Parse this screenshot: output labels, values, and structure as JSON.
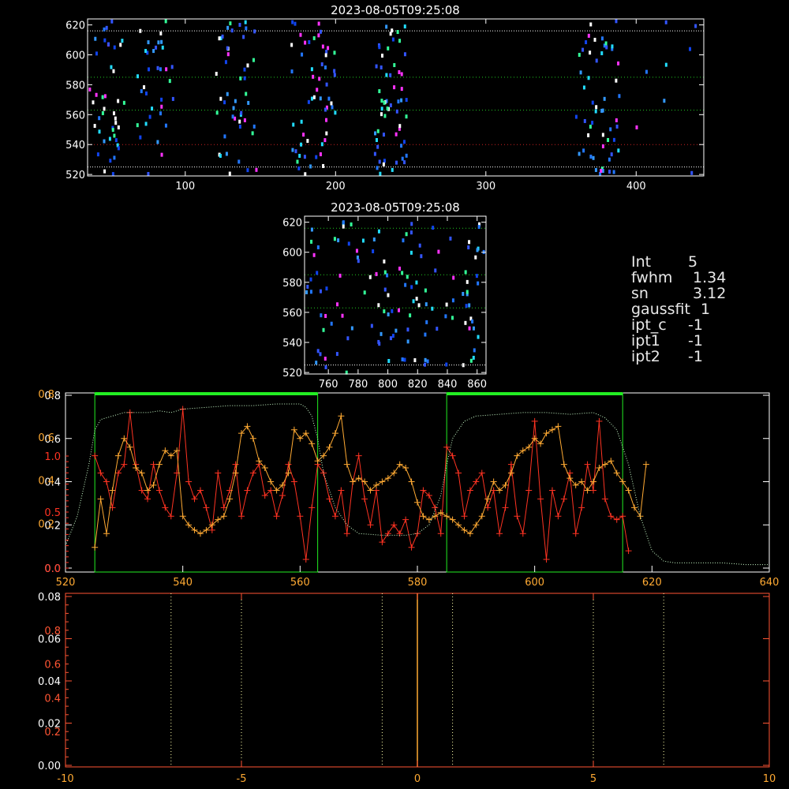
{
  "colors": {
    "axis": "#ffffff",
    "grid_green": "#22cc22",
    "grid_red": "#cc2222",
    "band_green": "#22ee22",
    "red_series": "#ff3322",
    "orange_series": "#ffaa33",
    "dotted_series": "#ccffcc",
    "lower_axis": "#ff5533",
    "lower_center": "#ffaa33",
    "lower_dotted": "#ffffaa"
  },
  "top_panel": {
    "title": "2023-08-05T09:25:08",
    "xlim": [
      35,
      445
    ],
    "ylim": [
      519,
      624
    ],
    "xticks": [
      100,
      200,
      300,
      400
    ],
    "yticks": [
      520,
      540,
      560,
      580,
      600,
      620
    ],
    "hlines_green": [
      585,
      563
    ],
    "hlines_red": [
      540
    ],
    "hlines_white": [
      616,
      525
    ],
    "clusters": [
      {
        "x": [
          36,
          60
        ],
        "n": 42
      },
      {
        "x": [
          68,
          92
        ],
        "n": 34
      },
      {
        "x": [
          120,
          148
        ],
        "n": 46
      },
      {
        "x": [
          170,
          200
        ],
        "n": 56
      },
      {
        "x": [
          226,
          248
        ],
        "n": 58
      },
      {
        "x": [
          360,
          390
        ],
        "n": 54
      },
      {
        "x": [
          400,
          440
        ],
        "n": 8
      }
    ]
  },
  "zoom_panel": {
    "title": "2023-08-05T09:25:08",
    "xlim": [
      744,
      866
    ],
    "ylim": [
      519,
      624
    ],
    "xticks": [
      760,
      780,
      800,
      820,
      840,
      860
    ],
    "yticks": [
      520,
      540,
      560,
      580,
      600,
      620
    ],
    "hlines_green": [
      616,
      585,
      563
    ],
    "hlines_white": [
      525
    ],
    "n_points": 130
  },
  "info": [
    {
      "key": "Int",
      "value": "5"
    },
    {
      "key": "fwhm",
      "value": " 1.34"
    },
    {
      "key": "sn",
      "value": " 3.12"
    },
    {
      "key": "gaussfit",
      "value": "1"
    },
    {
      "key": "ipt_c",
      "value": "-1"
    },
    {
      "key": "ipt1",
      "value": "-1"
    },
    {
      "key": "ipt2",
      "value": "-1"
    }
  ],
  "chart_data": [
    {
      "type": "line",
      "xlim": [
        520,
        640
      ],
      "ylim_left": [
        0,
        1.0
      ],
      "xticks": [
        520,
        540,
        560,
        580,
        600,
        620,
        640
      ],
      "left_ticks_red": [
        "0.0",
        "0.5",
        "1.0"
      ],
      "left_ticks_red_values": [
        0,
        0.5,
        1.0
      ],
      "left_ticks_white": [
        "0.0",
        "0.2",
        "0.4",
        "0.6",
        "0.8"
      ],
      "left_ticks_white_values": [
        0,
        0.2,
        0.4,
        0.6,
        0.8
      ],
      "left_ticks_orange": [
        "0.2",
        "0.4",
        "0.6",
        "0.8"
      ],
      "left_ticks_orange_values": [
        0.2,
        0.4,
        0.6,
        0.8
      ],
      "bands": [
        [
          525,
          563
        ],
        [
          585,
          615
        ]
      ],
      "series": [
        {
          "color": "red",
          "x": [
            525,
            526,
            527,
            528,
            529,
            530,
            531,
            532,
            533,
            534,
            535,
            536,
            537,
            538,
            539,
            540,
            541,
            542,
            543,
            544,
            545,
            546,
            547,
            548,
            549,
            550,
            551,
            552,
            553,
            554,
            555,
            556,
            557,
            558,
            559,
            560,
            561,
            562,
            563,
            564,
            565,
            566,
            567,
            568,
            569,
            570,
            571,
            572,
            573,
            574,
            575,
            576,
            577,
            578,
            579,
            580,
            581,
            582,
            583,
            584,
            585,
            586,
            587,
            588,
            589,
            590,
            591,
            592,
            593,
            594,
            595,
            596,
            597,
            598,
            599,
            600,
            601,
            602,
            603,
            604,
            605,
            606,
            607,
            608,
            609,
            610,
            611,
            612,
            613,
            614,
            615,
            616
          ],
          "y": [
            0.65,
            0.55,
            0.5,
            0.35,
            0.55,
            0.6,
            0.9,
            0.6,
            0.45,
            0.4,
            0.6,
            0.45,
            0.35,
            0.3,
            0.55,
            0.92,
            0.5,
            0.4,
            0.45,
            0.35,
            0.22,
            0.55,
            0.35,
            0.45,
            0.6,
            0.3,
            0.45,
            0.55,
            0.6,
            0.42,
            0.45,
            0.3,
            0.42,
            0.6,
            0.5,
            0.3,
            0.05,
            0.35,
            0.6,
            0.55,
            0.4,
            0.3,
            0.45,
            0.2,
            0.5,
            0.65,
            0.4,
            0.25,
            0.45,
            0.15,
            0.2,
            0.25,
            0.2,
            0.28,
            0.12,
            0.2,
            0.45,
            0.42,
            0.35,
            0.2,
            0.7,
            0.65,
            0.55,
            0.3,
            0.45,
            0.5,
            0.55,
            0.35,
            0.45,
            0.2,
            0.35,
            0.6,
            0.3,
            0.2,
            0.45,
            0.85,
            0.4,
            0.05,
            0.45,
            0.3,
            0.4,
            0.55,
            0.2,
            0.35,
            0.6,
            0.45,
            0.85,
            0.4,
            0.3,
            0.28,
            0.3,
            0.1
          ]
        },
        {
          "color": "orange",
          "x": [
            525,
            526,
            527,
            528,
            529,
            530,
            531,
            532,
            533,
            534,
            535,
            536,
            537,
            538,
            539,
            540,
            541,
            542,
            543,
            544,
            545,
            546,
            547,
            548,
            549,
            550,
            551,
            552,
            553,
            554,
            555,
            556,
            557,
            558,
            559,
            560,
            561,
            562,
            563,
            564,
            565,
            566,
            567,
            568,
            569,
            570,
            571,
            572,
            573,
            574,
            575,
            576,
            577,
            578,
            579,
            580,
            581,
            582,
            583,
            584,
            585,
            586,
            587,
            588,
            589,
            590,
            591,
            592,
            593,
            594,
            595,
            596,
            597,
            598,
            599,
            600,
            601,
            602,
            603,
            604,
            605,
            606,
            607,
            608,
            609,
            610,
            611,
            612,
            613,
            614,
            615,
            616,
            617,
            618,
            619
          ],
          "y": [
            0.12,
            0.4,
            0.2,
            0.45,
            0.65,
            0.75,
            0.7,
            0.58,
            0.55,
            0.45,
            0.48,
            0.6,
            0.68,
            0.65,
            0.68,
            0.3,
            0.25,
            0.22,
            0.2,
            0.22,
            0.25,
            0.28,
            0.3,
            0.4,
            0.55,
            0.78,
            0.82,
            0.75,
            0.62,
            0.58,
            0.5,
            0.45,
            0.48,
            0.55,
            0.8,
            0.75,
            0.78,
            0.72,
            0.62,
            0.65,
            0.7,
            0.78,
            0.88,
            0.6,
            0.5,
            0.52,
            0.5,
            0.45,
            0.48,
            0.5,
            0.52,
            0.55,
            0.6,
            0.58,
            0.5,
            0.38,
            0.3,
            0.28,
            0.3,
            0.32,
            0.3,
            0.28,
            0.25,
            0.22,
            0.2,
            0.25,
            0.3,
            0.4,
            0.5,
            0.45,
            0.48,
            0.55,
            0.65,
            0.68,
            0.7,
            0.75,
            0.72,
            0.78,
            0.8,
            0.82,
            0.6,
            0.52,
            0.48,
            0.5,
            0.45,
            0.5,
            0.58,
            0.6,
            0.62,
            0.55,
            0.5,
            0.45,
            0.35,
            0.3,
            0.6
          ]
        },
        {
          "color": "dotted",
          "x": [
            520,
            522,
            524,
            525,
            526,
            528,
            530,
            532,
            534,
            536,
            538,
            540,
            544,
            548,
            552,
            556,
            560,
            561,
            562,
            563,
            564,
            566,
            568,
            570,
            574,
            578,
            580,
            582,
            584,
            585,
            586,
            588,
            590,
            594,
            598,
            602,
            606,
            610,
            612,
            614,
            616,
            618,
            620,
            622,
            624,
            628,
            632,
            636,
            640
          ],
          "y": [
            0.13,
            0.3,
            0.6,
            0.8,
            0.86,
            0.88,
            0.9,
            0.9,
            0.9,
            0.91,
            0.9,
            0.92,
            0.93,
            0.94,
            0.94,
            0.95,
            0.95,
            0.93,
            0.88,
            0.75,
            0.55,
            0.35,
            0.25,
            0.2,
            0.19,
            0.19,
            0.2,
            0.25,
            0.42,
            0.6,
            0.75,
            0.85,
            0.88,
            0.89,
            0.9,
            0.9,
            0.89,
            0.9,
            0.87,
            0.8,
            0.6,
            0.3,
            0.1,
            0.04,
            0.03,
            0.03,
            0.03,
            0.02,
            0.02
          ]
        }
      ]
    },
    {
      "type": "line",
      "xlim": [
        -10,
        10
      ],
      "xticks": [
        -10,
        -5,
        0,
        5,
        10
      ],
      "left_ticks_white": [
        "0.00",
        "0.02",
        "0.04",
        "0.06",
        "0.08"
      ],
      "left_ticks_white_values": [
        0,
        0.02,
        0.04,
        0.06,
        0.08
      ],
      "left_ticks_white_max": 0.08,
      "left_ticks_red": [
        "0.2",
        "0.4",
        "0.6",
        "0.8"
      ],
      "left_ticks_red_values": [
        0.2,
        0.4,
        0.6,
        0.8
      ],
      "left_ticks_red_max": 1.0,
      "vlines_dotted": [
        -7,
        -5,
        -1,
        1,
        5,
        7
      ],
      "vline_center": 0
    }
  ]
}
